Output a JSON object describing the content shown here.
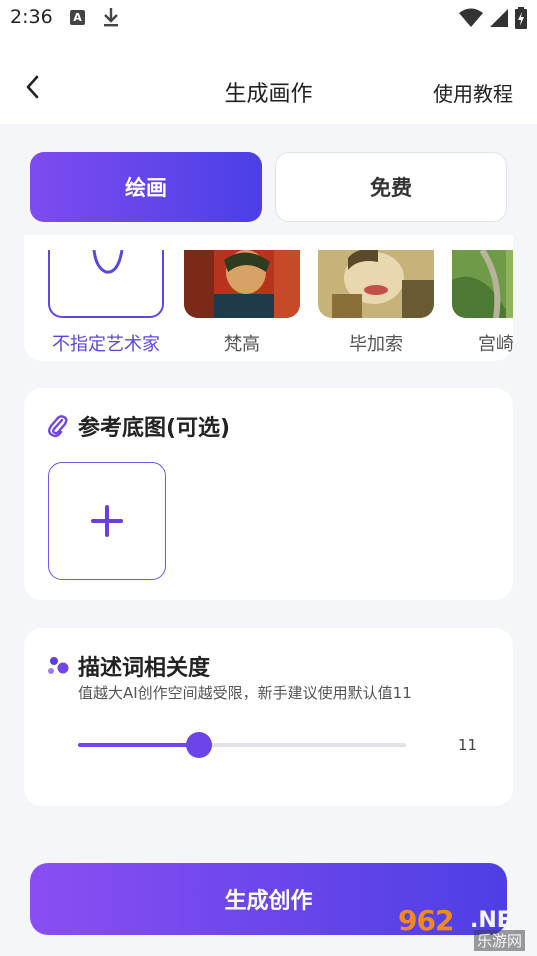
{
  "status_bar": {
    "time": "2:36",
    "notif_a": "A"
  },
  "app_bar": {
    "title": "生成画作",
    "help_label": "使用教程"
  },
  "tabs": [
    {
      "label": "绘画",
      "active": true
    },
    {
      "label": "免费",
      "active": false
    }
  ],
  "artists": [
    {
      "name": "不指定艺术家",
      "selected": true
    },
    {
      "name": "梵高",
      "selected": false
    },
    {
      "name": "毕加索",
      "selected": false
    },
    {
      "name": "宫崎",
      "selected": false
    }
  ],
  "reference": {
    "title": "参考底图(可选)"
  },
  "relevance": {
    "title": "描述词相关度",
    "subtitle": "值越大AI创作空间越受限，新手建议使用默认值11",
    "value": "11",
    "fraction": 0.368
  },
  "generate_button": "生成创作",
  "watermark": {
    "main": "962",
    "net": ".NET",
    "sub": "乐游网"
  },
  "colors": {
    "accent": "#6d44e8",
    "gradient_start": "#8a4ef3",
    "gradient_end": "#4d3fe5"
  }
}
